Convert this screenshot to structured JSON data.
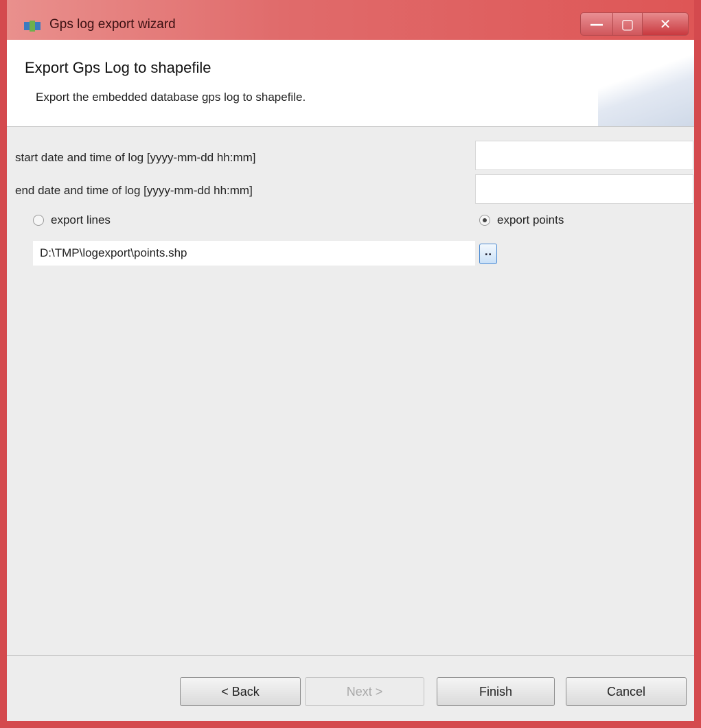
{
  "window": {
    "title": "Gps log export wizard",
    "controls": {
      "minimize": "—",
      "maximize": "▢",
      "close": "✕"
    }
  },
  "header": {
    "title": "Export Gps Log to shapefile",
    "description": "Export the embedded database gps log to shapefile."
  },
  "form": {
    "start_label": "start date and time of log [yyyy-mm-dd hh:mm]",
    "start_value": "",
    "end_label": "end date and time of log [yyyy-mm-dd hh:mm]",
    "end_value": "",
    "radio_lines_label": "export lines",
    "radio_lines_checked": false,
    "radio_points_label": "export points",
    "radio_points_checked": true,
    "path_value": "D:\\TMP\\logexport\\points.shp",
    "browse_label": ".."
  },
  "buttons": {
    "back": "< Back",
    "next": "Next >",
    "finish": "Finish",
    "cancel": "Cancel"
  },
  "colors": {
    "title_bar": "#de5656",
    "window_border": "#d44a4e",
    "dialog_bg": "#ededed"
  }
}
